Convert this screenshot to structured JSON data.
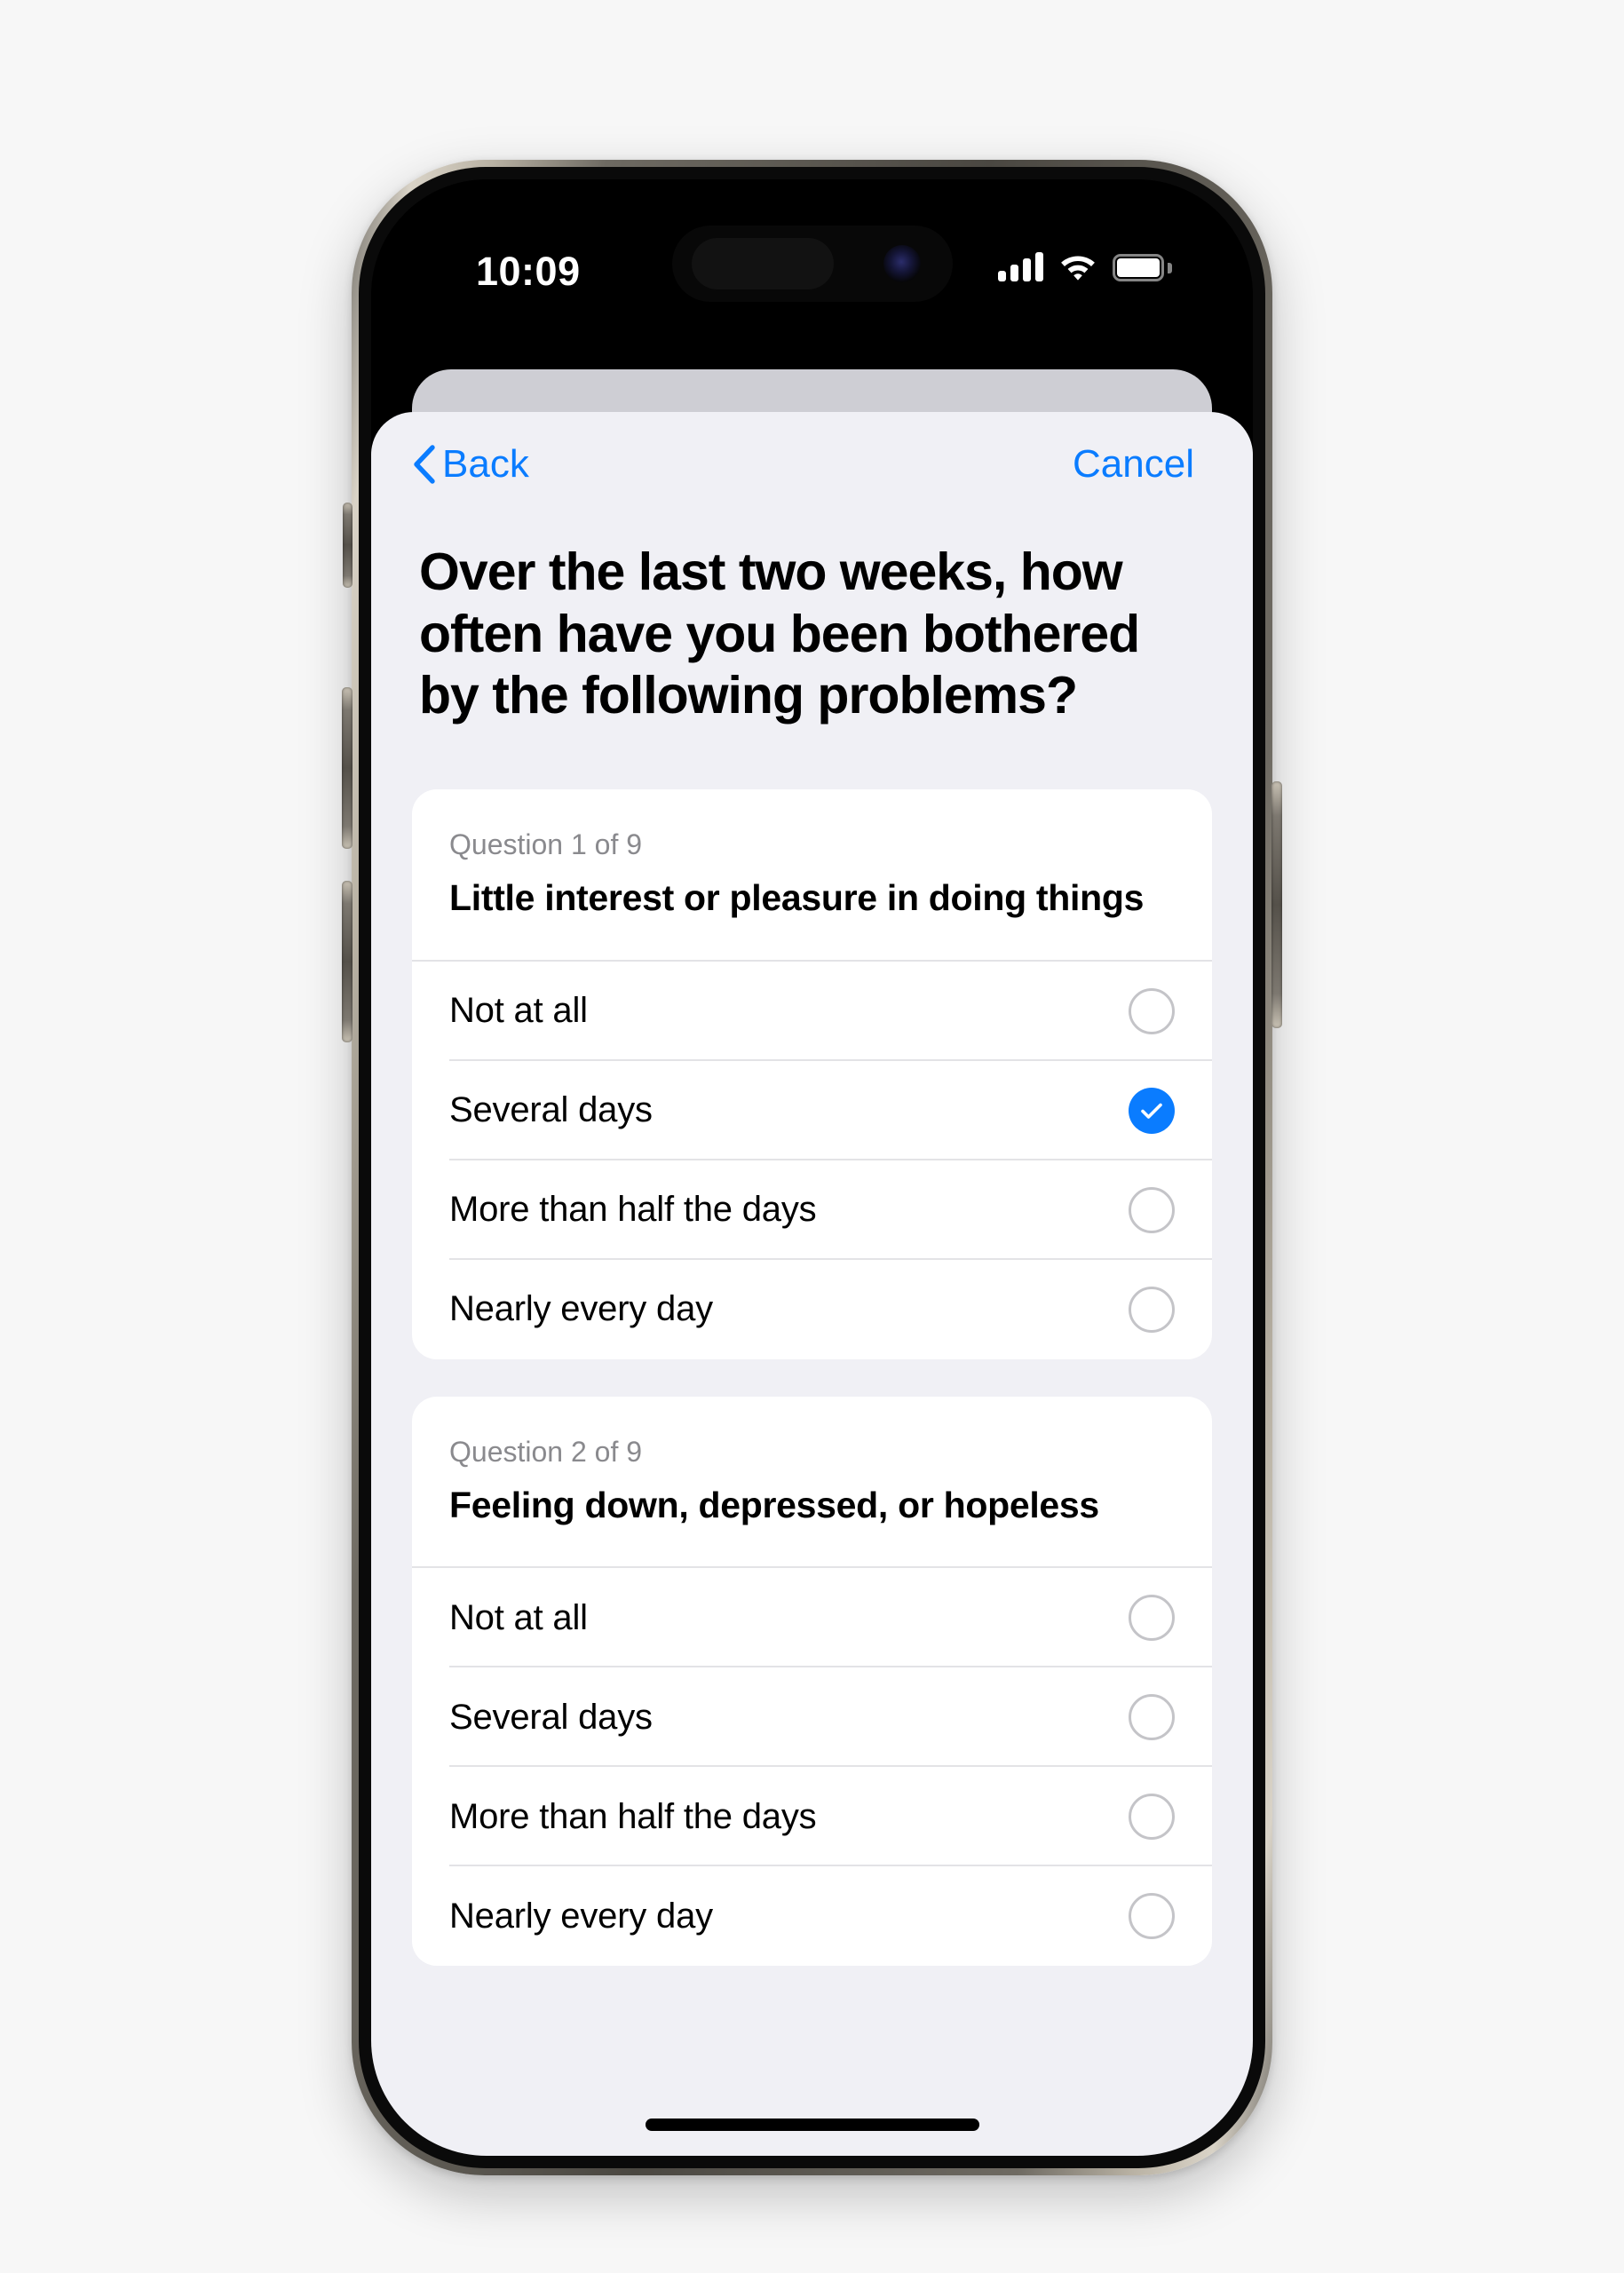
{
  "status_bar": {
    "time": "10:09",
    "cellular_icon": "cellular-signal-icon",
    "wifi_icon": "wifi-icon",
    "battery_icon": "battery-icon"
  },
  "nav": {
    "back_label": "Back",
    "cancel_label": "Cancel",
    "back_icon": "chevron-left-icon",
    "accent_color": "#0A7CFF"
  },
  "page_title": "Over the last two weeks, how often have you been bothered by the following problems?",
  "colors": {
    "background": "#F0F0F5",
    "card": "#FFFFFF",
    "accent": "#0A7CFF",
    "separator": "#E3E3E6",
    "secondary_text": "#8A8A8E"
  },
  "questions": [
    {
      "counter": "Question 1 of 9",
      "text": "Little interest or pleasure in doing things",
      "options": [
        {
          "label": "Not at all",
          "selected": false
        },
        {
          "label": "Several days",
          "selected": true
        },
        {
          "label": "More than half the days",
          "selected": false
        },
        {
          "label": "Nearly every day",
          "selected": false
        }
      ]
    },
    {
      "counter": "Question 2 of 9",
      "text": "Feeling down, depressed, or hopeless",
      "options": [
        {
          "label": "Not at all",
          "selected": false
        },
        {
          "label": "Several days",
          "selected": false
        },
        {
          "label": "More than half the days",
          "selected": false
        },
        {
          "label": "Nearly every day",
          "selected": false
        }
      ]
    }
  ]
}
